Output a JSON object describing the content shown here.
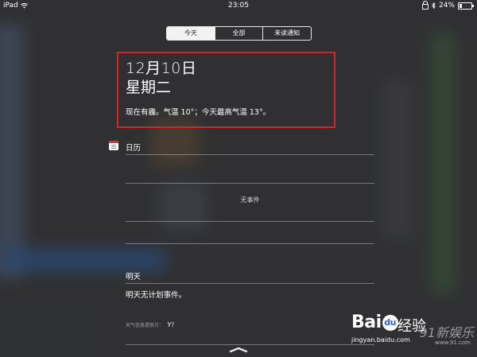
{
  "status_bar": {
    "device": "iPad",
    "time": "23:05",
    "battery_text": "24%",
    "battery_level": 0.24
  },
  "tabs": [
    {
      "label": "今天",
      "active": true
    },
    {
      "label": "全部",
      "active": false
    },
    {
      "label": "未读通知",
      "active": false
    }
  ],
  "today": {
    "date": "12月10日",
    "weekday": "星期二",
    "weather": "现在有霾。气温 10°；今天最高气温 13°。"
  },
  "calendar": {
    "label": "日历",
    "no_events": "无事件"
  },
  "tomorrow": {
    "label": "明天",
    "summary": "明天无计划事件。"
  },
  "weather_provider": {
    "label": "天气信息提供方：",
    "logo": "Y!"
  },
  "watermark": {
    "brand_left": "Bai",
    "brand_du": "du",
    "brand_right": "经验",
    "url": "jingyan.baidu.com",
    "site": "91新娱乐",
    "site_url": "www.91.com"
  },
  "colors": {
    "highlight_box": "#d4262a",
    "calendar_icon": "#e0312e"
  }
}
